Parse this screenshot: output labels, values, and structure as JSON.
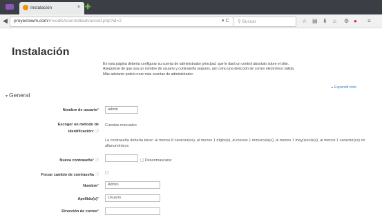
{
  "browser": {
    "tab_title": "Instalación",
    "tab_close": "×",
    "new_tab": "✚",
    "url_host": "proyectowm.com",
    "url_path": "/moodle/user/editadvanced.php?id=2",
    "reload": "▾ C",
    "search_placeholder": "Buscar",
    "toolbar_icons": [
      "star-icon",
      "reading-list-icon",
      "download-icon",
      "home-icon",
      "extension-icon",
      "stop-icon",
      "menu-icon"
    ]
  },
  "page": {
    "title": "Instalación",
    "intro": "En esta página debería configurar su cuenta de administrador principal, que le dará un control absoluto sobre el sitio. Asegúrese de que usa un nombre de usuario y contraseña seguros, así como una dirección de correo electrónico válida. Más adelante podrá crear más cuentas de administrador.",
    "expand_all": "▸ Expandir todo",
    "section_title": "General",
    "section_arrow": "▾",
    "fields": {
      "username_label": "Nombre de usuario",
      "username_value": "admin",
      "auth_label_line1": "Escoger un método de",
      "auth_label_line2": "identificación:",
      "auth_value": "Cuentas manuales",
      "password_policy": "La contraseña debería tener: al menos 8 caracter(es), al menos 1 dígito(s), al menos 1 minúscula(s), al menos 1 mayúscula(s), al menos 1 caracter(es) no alfanuméricos",
      "new_password_label": "Nueva contraseña",
      "unmask_label": "Desenmascarar",
      "force_change_label": "Forzar cambio de contraseña",
      "firstname_label": "Nombre",
      "firstname_value": "Admin",
      "lastname_label": "Apellido(s)",
      "lastname_value": "Usuario",
      "email_label": "Dirección de correo"
    },
    "required_mark": "*",
    "help_mark": "ⓘ"
  }
}
